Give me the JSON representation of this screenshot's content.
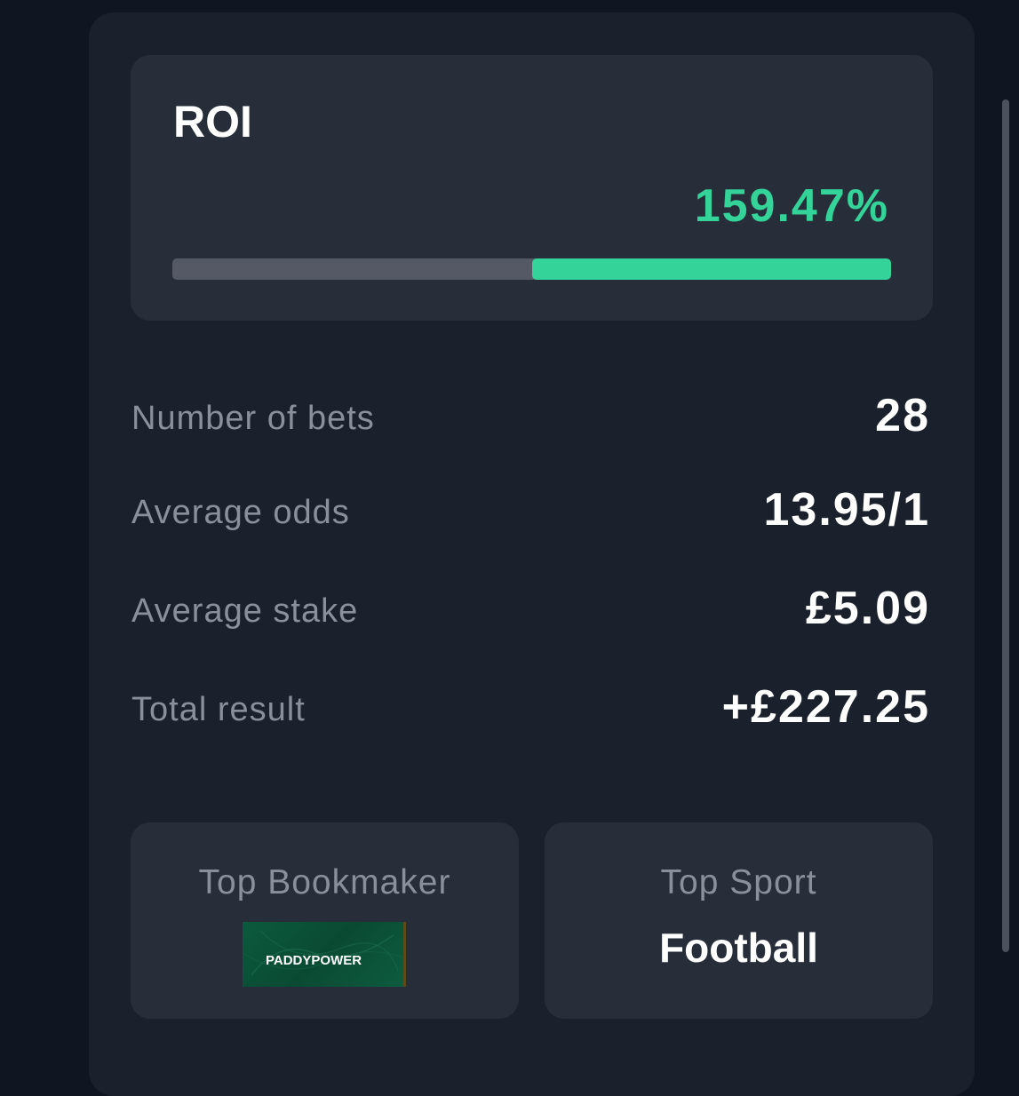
{
  "roi": {
    "title": "ROI",
    "value": "159.47%",
    "bar_fill_fraction": 0.5,
    "bar_color": "#34d399"
  },
  "stats": [
    {
      "label": "Number of bets",
      "value": "28"
    },
    {
      "label": "Average odds",
      "value": "13.95/1"
    },
    {
      "label": "Average stake",
      "value": "£5.09"
    },
    {
      "label": "Total result",
      "value": "+£227.25"
    }
  ],
  "top_bookmaker": {
    "label": "Top Bookmaker",
    "logo_text": "PADDYPOWER",
    "logo_icon": "paddypower-logo"
  },
  "top_sport": {
    "label": "Top Sport",
    "value": "Football"
  },
  "colors": {
    "page_bg": "#0f1521",
    "panel_bg": "#1b212c",
    "card_bg": "#272e39",
    "accent_green": "#34d399",
    "muted_text": "#8a909b"
  }
}
